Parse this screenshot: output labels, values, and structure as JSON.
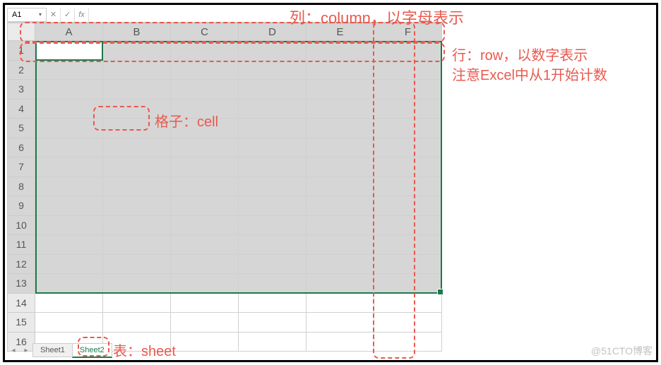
{
  "formula_bar": {
    "name_box_value": "A1",
    "fx_label": "fx"
  },
  "columns": [
    "A",
    "B",
    "C",
    "D",
    "E",
    "F"
  ],
  "rows": [
    1,
    2,
    3,
    4,
    5,
    6,
    7,
    8,
    9,
    10,
    11,
    12,
    13,
    14,
    15,
    16
  ],
  "selected_row_count": 13,
  "sheet_tabs": {
    "tab1": "Sheet1",
    "tab2": "Sheet2"
  },
  "annotations": {
    "column_label": "列：column，以字母表示",
    "row_label_line1": "行：row，以数字表示",
    "row_label_line2": "注意Excel中从1开始计数",
    "cell_label": "格子：cell",
    "sheet_label": "表：sheet"
  },
  "watermark": "@51CTO博客"
}
